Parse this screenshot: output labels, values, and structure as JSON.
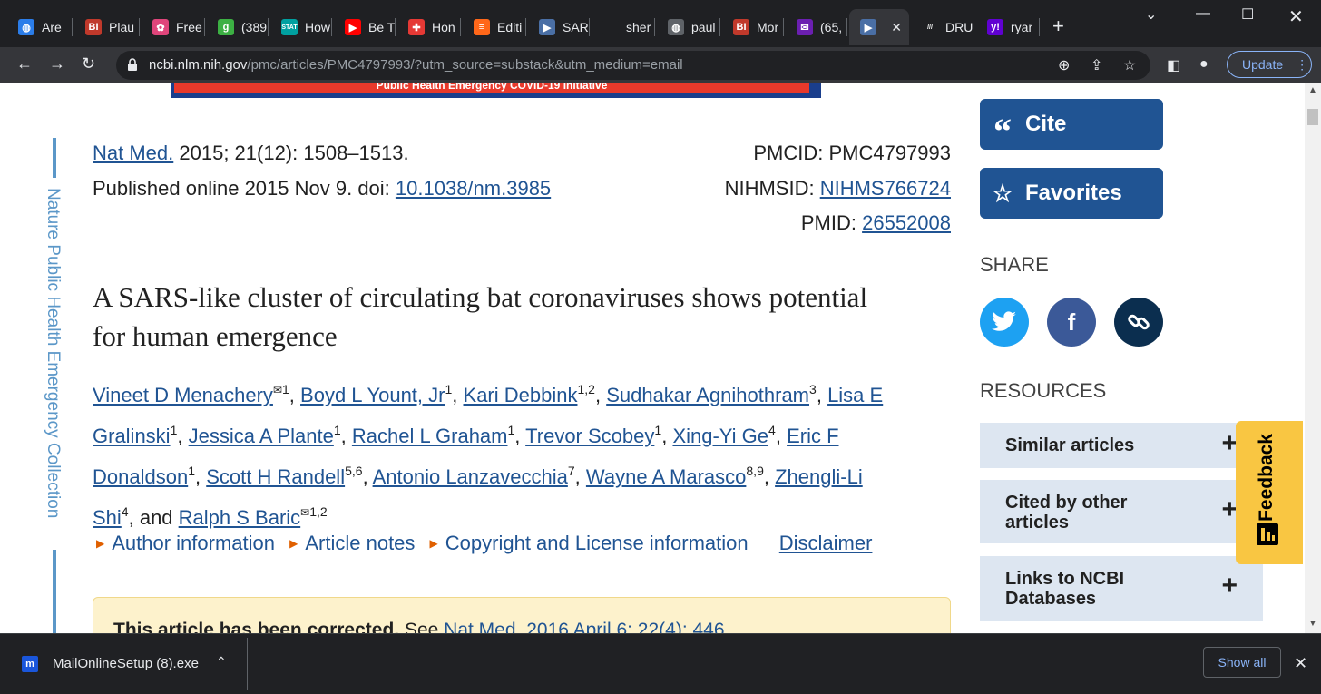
{
  "tabs": [
    {
      "label": "Are",
      "color": "#2b7de9",
      "glyph": "◍"
    },
    {
      "label": "Plau",
      "color": "#c0392b",
      "glyph": "BI"
    },
    {
      "label": "Free",
      "color": "#e0457b",
      "glyph": "✿"
    },
    {
      "label": "(389",
      "color": "#3cb043",
      "glyph": "g"
    },
    {
      "label": "How",
      "color": "#00a0a0",
      "glyph": "STAT"
    },
    {
      "label": "Be T",
      "color": "#ff0000",
      "glyph": "▶"
    },
    {
      "label": "Hon",
      "color": "#e53935",
      "glyph": "✚"
    },
    {
      "label": "Editi",
      "color": "#ff6719",
      "glyph": "≡"
    },
    {
      "label": "SAR",
      "color": "#4a6fa5",
      "glyph": "▶"
    },
    {
      "label": "sher",
      "color": "#1f2023",
      "glyph": ""
    },
    {
      "label": "paul",
      "color": "#5f6368",
      "glyph": "◍"
    },
    {
      "label": "Mor",
      "color": "#c0392b",
      "glyph": "BI"
    },
    {
      "label": "(65,",
      "color": "#6b1fb1",
      "glyph": "✉"
    },
    {
      "label": "",
      "color": "#4a6fa5",
      "glyph": "▶"
    },
    {
      "label": "DRU",
      "color": "#1f2023",
      "glyph": "///"
    },
    {
      "label": "ryar",
      "color": "#6001d2",
      "glyph": "y!"
    }
  ],
  "address": {
    "host": "ncbi.nlm.nih.gov",
    "path": "/pmc/articles/PMC4797993/?utm_source=substack&utm_medium=email"
  },
  "update_label": "Update",
  "banner_text": "Public Health Emergency COVID-19 Initiative",
  "side_collection": "Nature Public Health Emergency Collection",
  "citation": {
    "journal": "Nat Med.",
    "details": " 2015; 21(12): 1508–1513.",
    "published": "Published online 2015 Nov 9. doi: ",
    "doi": "10.1038/nm.3985",
    "pmcid": "PMCID: PMC4797993",
    "nihmsid_label": "NIHMSID: ",
    "nihmsid": "NIHMS766724",
    "pmid_label": "PMID: ",
    "pmid": "26552008"
  },
  "title": "A SARS-like cluster of circulating bat coronaviruses shows potential for human emergence",
  "authors": [
    {
      "name": "Vineet D Menachery",
      "sup": "1",
      "mail": true,
      "sep": " "
    },
    {
      "name": "Boyd L Yount, Jr",
      "sup": "1",
      "mail": false,
      "sep": " "
    },
    {
      "name": "Kari Debbink",
      "sup": "1,2",
      "mail": false,
      "sep": " "
    },
    {
      "name": "Sudhakar Agnihothram",
      "sup": "3",
      "mail": false,
      "sep": " "
    },
    {
      "name": "Lisa E Gralinski",
      "sup": "1",
      "mail": false,
      "sep": " "
    },
    {
      "name": "Jessica A Plante",
      "sup": "1",
      "mail": false,
      "sep": " "
    },
    {
      "name": "Rachel L Graham",
      "sup": "1",
      "mail": false,
      "sep": " "
    },
    {
      "name": "Trevor Scobey",
      "sup": "1",
      "mail": false,
      "sep": " "
    },
    {
      "name": "Xing-Yi Ge",
      "sup": "4",
      "mail": false,
      "sep": " "
    },
    {
      "name": "Eric F Donaldson",
      "sup": "1",
      "mail": false,
      "sep": " "
    },
    {
      "name": "Scott H Randell",
      "sup": "5,6",
      "mail": false,
      "sep": " "
    },
    {
      "name": "Antonio Lanzavecchia",
      "sup": "7",
      "mail": false,
      "sep": " "
    },
    {
      "name": "Wayne A Marasco",
      "sup": "8,9",
      "mail": false,
      "sep": " "
    },
    {
      "name": "Zhengli-Li Shi",
      "sup": "4",
      "mail": false,
      "sep": " and "
    },
    {
      "name": "Ralph S Baric",
      "sup": "1,2",
      "mail": true,
      "sep": ""
    }
  ],
  "meta_links": {
    "author_info": "Author information",
    "article_notes": "Article notes",
    "copyright": "Copyright and License information",
    "disclaimer": "Disclaimer"
  },
  "notice": {
    "bold": "This article has been corrected.",
    "see": " See ",
    "link": "Nat Med. 2016 April 6; 22(4): 446."
  },
  "sidebar": {
    "cite_label": "Cite",
    "favorites_label": "Favorites",
    "share_heading": "SHARE",
    "resources_heading": "RESOURCES",
    "resources": [
      {
        "line1": "Similar articles",
        "line2": ""
      },
      {
        "line1": "Cited by other",
        "line2": "articles"
      },
      {
        "line1": "Links to NCBI",
        "line2": "Databases"
      }
    ]
  },
  "feedback_label": "Feedback",
  "download": {
    "filename": "MailOnlineSetup (8).exe",
    "show_all": "Show all"
  },
  "colors": {
    "link": "#205493",
    "twitter": "#1da1f2",
    "facebook": "#3b5998",
    "copy_link": "#0b2e4f"
  }
}
